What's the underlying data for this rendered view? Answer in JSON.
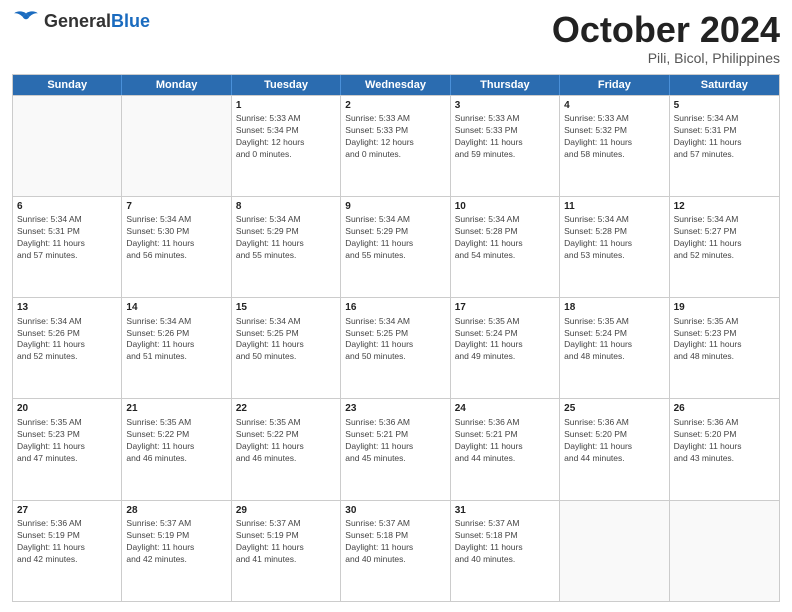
{
  "header": {
    "logo_general": "General",
    "logo_blue": "Blue",
    "month": "October 2024",
    "location": "Pili, Bicol, Philippines"
  },
  "days_of_week": [
    "Sunday",
    "Monday",
    "Tuesday",
    "Wednesday",
    "Thursday",
    "Friday",
    "Saturday"
  ],
  "weeks": [
    [
      {
        "day": "",
        "detail": ""
      },
      {
        "day": "",
        "detail": ""
      },
      {
        "day": "1",
        "detail": "Sunrise: 5:33 AM\nSunset: 5:34 PM\nDaylight: 12 hours\nand 0 minutes."
      },
      {
        "day": "2",
        "detail": "Sunrise: 5:33 AM\nSunset: 5:33 PM\nDaylight: 12 hours\nand 0 minutes."
      },
      {
        "day": "3",
        "detail": "Sunrise: 5:33 AM\nSunset: 5:33 PM\nDaylight: 11 hours\nand 59 minutes."
      },
      {
        "day": "4",
        "detail": "Sunrise: 5:33 AM\nSunset: 5:32 PM\nDaylight: 11 hours\nand 58 minutes."
      },
      {
        "day": "5",
        "detail": "Sunrise: 5:34 AM\nSunset: 5:31 PM\nDaylight: 11 hours\nand 57 minutes."
      }
    ],
    [
      {
        "day": "6",
        "detail": "Sunrise: 5:34 AM\nSunset: 5:31 PM\nDaylight: 11 hours\nand 57 minutes."
      },
      {
        "day": "7",
        "detail": "Sunrise: 5:34 AM\nSunset: 5:30 PM\nDaylight: 11 hours\nand 56 minutes."
      },
      {
        "day": "8",
        "detail": "Sunrise: 5:34 AM\nSunset: 5:29 PM\nDaylight: 11 hours\nand 55 minutes."
      },
      {
        "day": "9",
        "detail": "Sunrise: 5:34 AM\nSunset: 5:29 PM\nDaylight: 11 hours\nand 55 minutes."
      },
      {
        "day": "10",
        "detail": "Sunrise: 5:34 AM\nSunset: 5:28 PM\nDaylight: 11 hours\nand 54 minutes."
      },
      {
        "day": "11",
        "detail": "Sunrise: 5:34 AM\nSunset: 5:28 PM\nDaylight: 11 hours\nand 53 minutes."
      },
      {
        "day": "12",
        "detail": "Sunrise: 5:34 AM\nSunset: 5:27 PM\nDaylight: 11 hours\nand 52 minutes."
      }
    ],
    [
      {
        "day": "13",
        "detail": "Sunrise: 5:34 AM\nSunset: 5:26 PM\nDaylight: 11 hours\nand 52 minutes."
      },
      {
        "day": "14",
        "detail": "Sunrise: 5:34 AM\nSunset: 5:26 PM\nDaylight: 11 hours\nand 51 minutes."
      },
      {
        "day": "15",
        "detail": "Sunrise: 5:34 AM\nSunset: 5:25 PM\nDaylight: 11 hours\nand 50 minutes."
      },
      {
        "day": "16",
        "detail": "Sunrise: 5:34 AM\nSunset: 5:25 PM\nDaylight: 11 hours\nand 50 minutes."
      },
      {
        "day": "17",
        "detail": "Sunrise: 5:35 AM\nSunset: 5:24 PM\nDaylight: 11 hours\nand 49 minutes."
      },
      {
        "day": "18",
        "detail": "Sunrise: 5:35 AM\nSunset: 5:24 PM\nDaylight: 11 hours\nand 48 minutes."
      },
      {
        "day": "19",
        "detail": "Sunrise: 5:35 AM\nSunset: 5:23 PM\nDaylight: 11 hours\nand 48 minutes."
      }
    ],
    [
      {
        "day": "20",
        "detail": "Sunrise: 5:35 AM\nSunset: 5:23 PM\nDaylight: 11 hours\nand 47 minutes."
      },
      {
        "day": "21",
        "detail": "Sunrise: 5:35 AM\nSunset: 5:22 PM\nDaylight: 11 hours\nand 46 minutes."
      },
      {
        "day": "22",
        "detail": "Sunrise: 5:35 AM\nSunset: 5:22 PM\nDaylight: 11 hours\nand 46 minutes."
      },
      {
        "day": "23",
        "detail": "Sunrise: 5:36 AM\nSunset: 5:21 PM\nDaylight: 11 hours\nand 45 minutes."
      },
      {
        "day": "24",
        "detail": "Sunrise: 5:36 AM\nSunset: 5:21 PM\nDaylight: 11 hours\nand 44 minutes."
      },
      {
        "day": "25",
        "detail": "Sunrise: 5:36 AM\nSunset: 5:20 PM\nDaylight: 11 hours\nand 44 minutes."
      },
      {
        "day": "26",
        "detail": "Sunrise: 5:36 AM\nSunset: 5:20 PM\nDaylight: 11 hours\nand 43 minutes."
      }
    ],
    [
      {
        "day": "27",
        "detail": "Sunrise: 5:36 AM\nSunset: 5:19 PM\nDaylight: 11 hours\nand 42 minutes."
      },
      {
        "day": "28",
        "detail": "Sunrise: 5:37 AM\nSunset: 5:19 PM\nDaylight: 11 hours\nand 42 minutes."
      },
      {
        "day": "29",
        "detail": "Sunrise: 5:37 AM\nSunset: 5:19 PM\nDaylight: 11 hours\nand 41 minutes."
      },
      {
        "day": "30",
        "detail": "Sunrise: 5:37 AM\nSunset: 5:18 PM\nDaylight: 11 hours\nand 40 minutes."
      },
      {
        "day": "31",
        "detail": "Sunrise: 5:37 AM\nSunset: 5:18 PM\nDaylight: 11 hours\nand 40 minutes."
      },
      {
        "day": "",
        "detail": ""
      },
      {
        "day": "",
        "detail": ""
      }
    ]
  ]
}
